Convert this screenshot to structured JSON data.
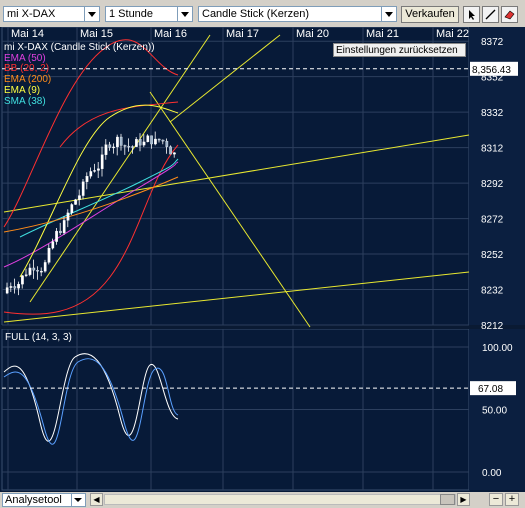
{
  "toolbar": {
    "instrument": "mi X-DAX",
    "interval": "1 Stunde",
    "chart_type": "Candle Stick (Kerzen)",
    "sell_label": "Verkaufen"
  },
  "chart": {
    "x_labels": [
      "Mai 14",
      "Mai 15",
      "Mai 16",
      "Mai 17",
      "Mai 20",
      "Mai 21",
      "Mai 22"
    ],
    "reset_label": "Einstellungen zurücksetzen",
    "legend_title": "mi X-DAX (Candle Stick (Kerzen))",
    "indicators": [
      {
        "label": "EMA (50)",
        "color": "#e040e0"
      },
      {
        "label": "BB (20, 2)",
        "color": "#ff3030"
      },
      {
        "label": "EMA (200)",
        "color": "#ff8c1a"
      },
      {
        "label": "EMA (9)",
        "color": "#ffff40"
      },
      {
        "label": "SMA (38)",
        "color": "#40e0e0"
      }
    ],
    "price_labels": [
      "8372",
      "8352",
      "8332",
      "8312",
      "8292",
      "8272",
      "8252",
      "8232",
      "8212"
    ],
    "last_price": "8,356.43",
    "osc_title": "FULL (14, 3, 3)",
    "osc_labels": [
      "100.00",
      "50.00",
      "0.00"
    ],
    "osc_last": "67.08"
  },
  "chart_data": {
    "type": "candlestick",
    "instrument": "mi X-DAX",
    "x_ticks": [
      "Mai 14",
      "Mai 15",
      "Mai 16",
      "Mai 17",
      "Mai 20",
      "Mai 21",
      "Mai 22"
    ],
    "ylim": [
      8212,
      8380
    ],
    "last": 8356.43,
    "osc_ylim": [
      0,
      100
    ],
    "osc_last": 67.08
  },
  "bottom": {
    "tool_label": "Analysetool"
  }
}
